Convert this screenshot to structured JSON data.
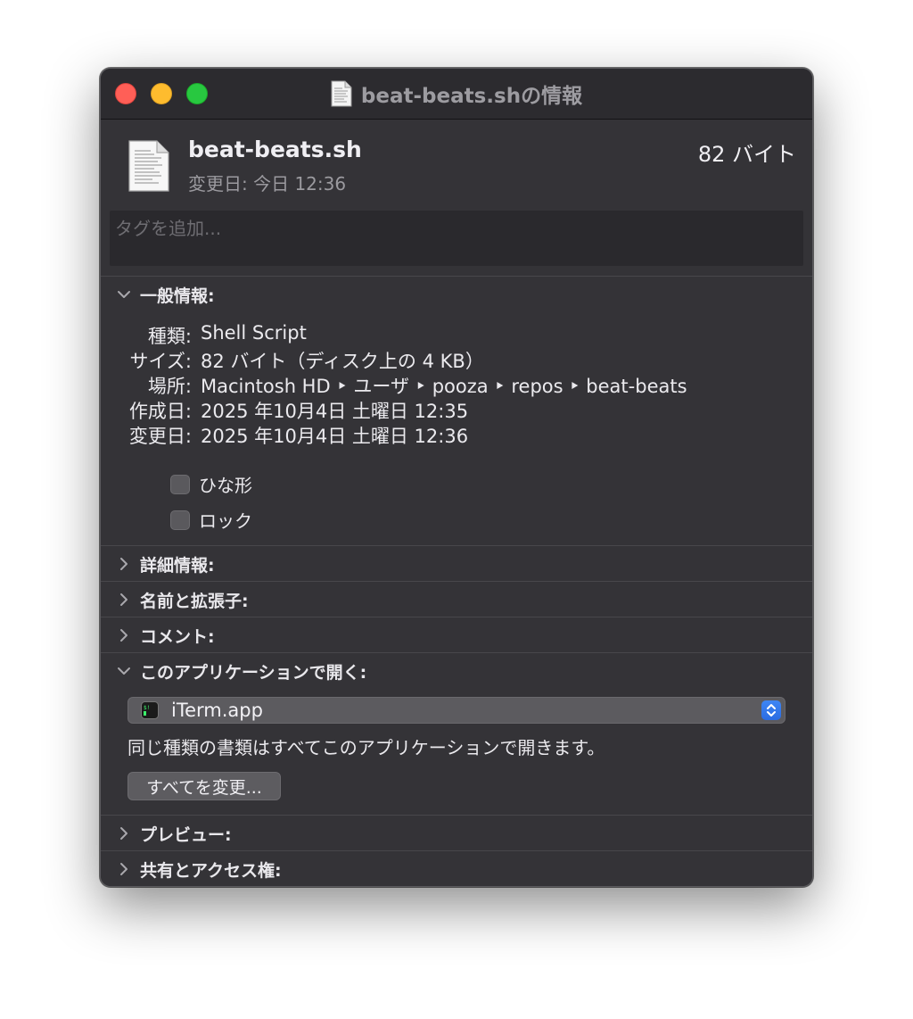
{
  "window": {
    "title": "beat-beats.shの情報"
  },
  "header": {
    "filename": "beat-beats.sh",
    "modified": "変更日: 今日 12:36",
    "size": "82 バイト"
  },
  "tags": {
    "placeholder": "タグを追加..."
  },
  "general": {
    "heading": "一般情報:",
    "rows": [
      {
        "key": "種類:",
        "value": "Shell Script"
      },
      {
        "key": "サイズ:",
        "value": "82 バイト（ディスク上の 4 KB）"
      },
      {
        "key": "場所:",
        "value": "Macintosh HD ‣ ユーザ ‣ pooza ‣ repos ‣ beat-beats"
      },
      {
        "key": "作成日:",
        "value": "2025 年10月4日 土曜日 12:35"
      },
      {
        "key": "変更日:",
        "value": "2025 年10月4日 土曜日 12:36"
      }
    ],
    "stationery_label": "ひな形",
    "locked_label": "ロック"
  },
  "sections": {
    "more_info": "詳細情報:",
    "name_extension": "名前と拡張子:",
    "comments": "コメント:",
    "open_with": "このアプリケーションで開く:",
    "preview": "プレビュー:",
    "sharing": "共有とアクセス権:"
  },
  "open_with": {
    "selected_app": "iTerm.app",
    "note": "同じ種類の書類はすべてこのアプリケーションで開きます。",
    "change_all_label": "すべてを変更..."
  },
  "icons": {
    "document": "document-icon",
    "terminal": "iterm-app-icon",
    "disclosure_open": "chevron-down-icon",
    "disclosure_closed": "chevron-right-icon"
  },
  "colors": {
    "close": "#ff5f57",
    "minimize": "#febc2e",
    "zoom": "#28c840",
    "accent": "#2f72e8"
  }
}
